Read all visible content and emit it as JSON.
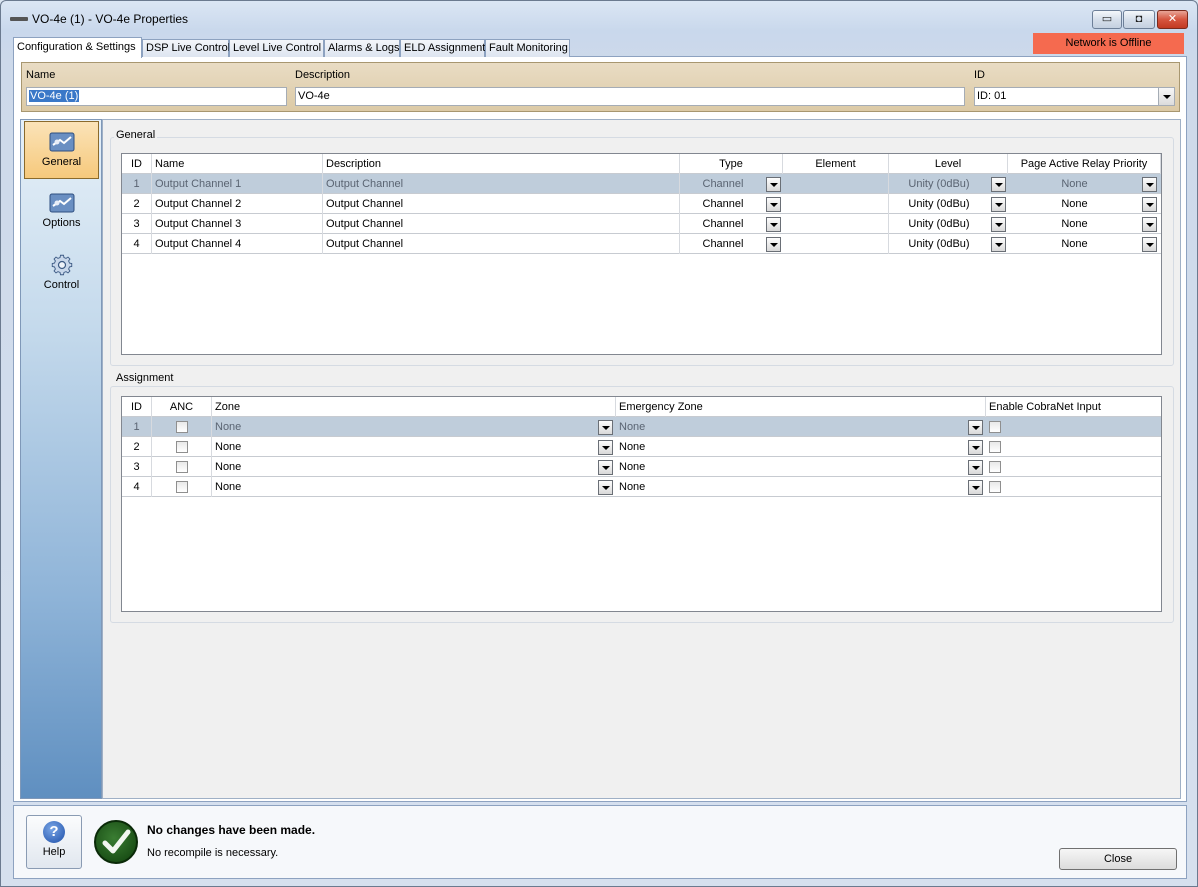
{
  "window": {
    "title": "VO-4e (1) - VO-4e Properties",
    "min_glyph": "▭",
    "max_glyph": "◘",
    "close_glyph": "✕"
  },
  "tabs": [
    {
      "label": "Configuration & Settings"
    },
    {
      "label": "DSP Live Control"
    },
    {
      "label": "Level Live Control"
    },
    {
      "label": "Alarms & Logs"
    },
    {
      "label": "ELD Assignment"
    },
    {
      "label": "Fault Monitoring"
    }
  ],
  "network_status": "Network is Offline",
  "header": {
    "name_label": "Name",
    "name_value": "VO-4e (1)",
    "description_label": "Description",
    "description_value": "VO-4e",
    "id_label": "ID",
    "id_value": "ID: 01"
  },
  "nav": [
    {
      "label": "General",
      "icon": "general-icon"
    },
    {
      "label": "Options",
      "icon": "options-icon"
    },
    {
      "label": "Control",
      "icon": "gear-icon"
    }
  ],
  "general": {
    "title": "General",
    "columns": [
      "ID",
      "Name",
      "Description",
      "Type",
      "Element",
      "Level",
      "Page Active Relay Priority"
    ],
    "rows": [
      {
        "id": "1",
        "name": "Output Channel 1",
        "description": "Output Channel",
        "type": "Channel",
        "element": "",
        "level": "Unity (0dBu)",
        "priority": "None"
      },
      {
        "id": "2",
        "name": "Output Channel 2",
        "description": "Output Channel",
        "type": "Channel",
        "element": "",
        "level": "Unity (0dBu)",
        "priority": "None"
      },
      {
        "id": "3",
        "name": "Output Channel 3",
        "description": "Output Channel",
        "type": "Channel",
        "element": "",
        "level": "Unity (0dBu)",
        "priority": "None"
      },
      {
        "id": "4",
        "name": "Output Channel 4",
        "description": "Output Channel",
        "type": "Channel",
        "element": "",
        "level": "Unity (0dBu)",
        "priority": "None"
      }
    ]
  },
  "assignment": {
    "title": "Assignment",
    "columns": [
      "ID",
      "ANC",
      "Zone",
      "Emergency Zone",
      "Enable CobraNet Input"
    ],
    "rows": [
      {
        "id": "1",
        "zone": "None",
        "emergency_zone": "None"
      },
      {
        "id": "2",
        "zone": "None",
        "emergency_zone": "None"
      },
      {
        "id": "3",
        "zone": "None",
        "emergency_zone": "None"
      },
      {
        "id": "4",
        "zone": "None",
        "emergency_zone": "None"
      }
    ]
  },
  "footer": {
    "help_label": "Help",
    "help_glyph": "?",
    "status_title": "No changes have been made.",
    "status_sub": "No recompile is necessary.",
    "close_label": "Close"
  },
  "colors": {
    "offline": "#f56a4f",
    "selected_row": "#bfcddb",
    "nav_active": "#f6c97c"
  }
}
